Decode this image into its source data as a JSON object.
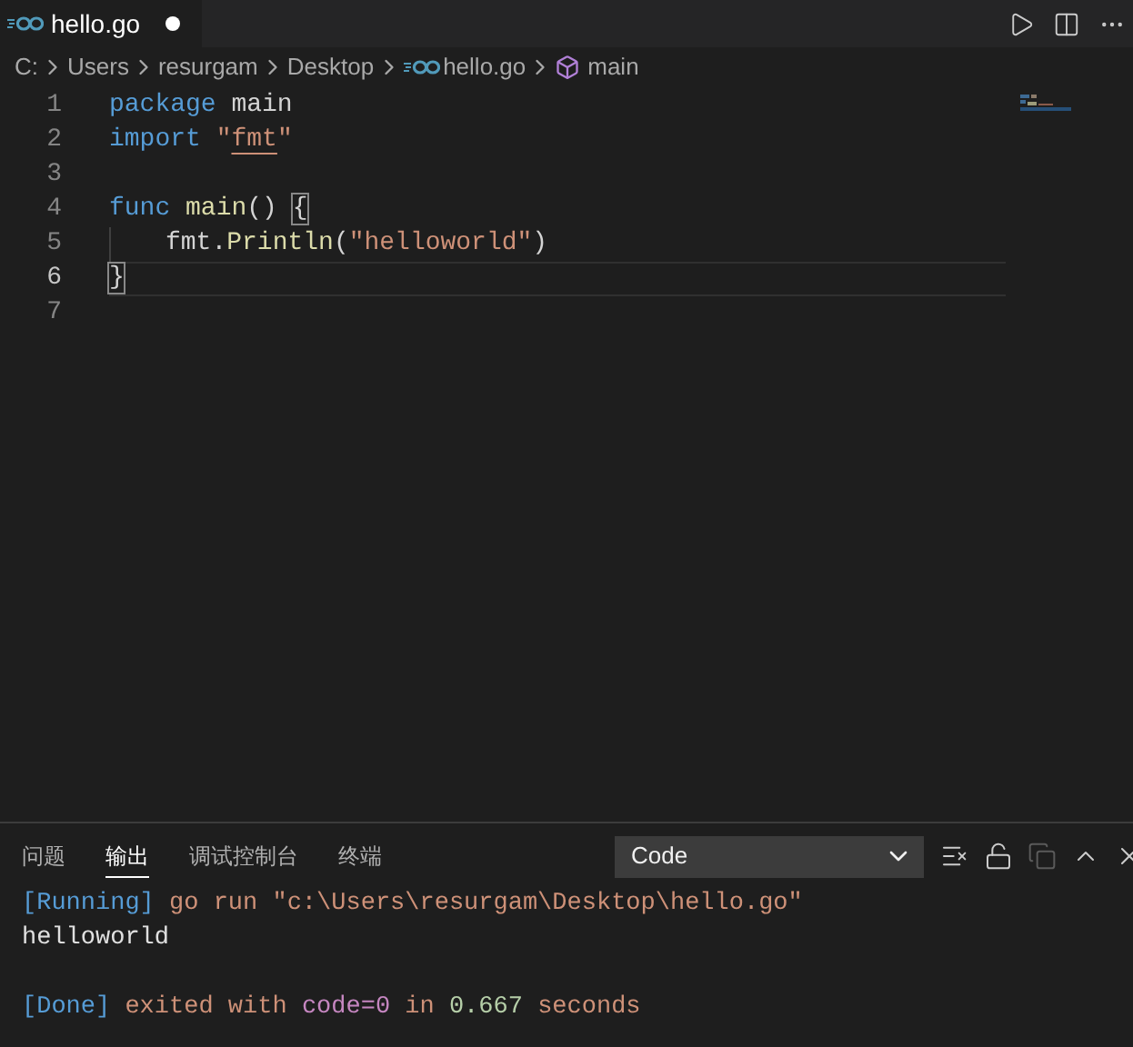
{
  "tab": {
    "label": "hello.go",
    "modified": true,
    "selected": true
  },
  "breadcrumbs": [
    {
      "label": "C:",
      "kind": "folder"
    },
    {
      "label": "Users",
      "kind": "folder"
    },
    {
      "label": "resurgam",
      "kind": "folder"
    },
    {
      "label": "Desktop",
      "kind": "folder"
    },
    {
      "label": "hello.go",
      "kind": "file"
    },
    {
      "label": "main",
      "kind": "symbol"
    }
  ],
  "code_lines": [
    {
      "number": "1",
      "current": false,
      "indent": false,
      "tokens": [
        {
          "text": "package",
          "kind": "keyword"
        },
        {
          "text": " main",
          "kind": "plain"
        }
      ]
    },
    {
      "number": "2",
      "current": false,
      "indent": false,
      "tokens": [
        {
          "text": "import",
          "kind": "keyword"
        },
        {
          "text": " \"",
          "kind": "string"
        },
        {
          "text": "fmt",
          "kind": "string",
          "underline": true
        },
        {
          "text": "\"",
          "kind": "string"
        }
      ]
    },
    {
      "number": "3",
      "current": false,
      "indent": false
    },
    {
      "number": "4",
      "current": false,
      "indent": false,
      "tokens": [
        {
          "text": "func",
          "kind": "keyword"
        },
        {
          "text": " main",
          "kind": "function"
        },
        {
          "text": "() ",
          "kind": "plain"
        },
        {
          "text": "{",
          "kind": "plain",
          "bracket_match": true
        }
      ]
    },
    {
      "number": "5",
      "current": false,
      "indent": true,
      "tokens": [
        {
          "text": "fmt",
          "kind": "plain"
        },
        {
          "text": ".",
          "kind": "plain"
        },
        {
          "text": "Println",
          "kind": "function"
        },
        {
          "text": "(",
          "kind": "plain"
        },
        {
          "text": "\"helloworld\"",
          "kind": "string"
        },
        {
          "text": ")",
          "kind": "plain"
        }
      ]
    },
    {
      "number": "6",
      "current": true,
      "indent": false,
      "tokens": [
        {
          "text": "}",
          "kind": "plain",
          "bracket_match": true
        }
      ]
    },
    {
      "number": "7",
      "current": false,
      "indent": false
    }
  ],
  "panel": {
    "tabs": [
      {
        "label": "问题",
        "selected": false
      },
      {
        "label": "输出",
        "selected": true
      },
      {
        "label": "调试控制台",
        "selected": false
      },
      {
        "label": "终端",
        "selected": false
      }
    ],
    "channel_select": {
      "value": "Code"
    },
    "output_lines": [
      {
        "kind": "text",
        "tokens": [
          {
            "text": "[Running]",
            "kind": "bracket"
          },
          {
            "text": " go run \"c:\\Users\\resurgam\\Desktop\\hello.go\"",
            "kind": "text"
          }
        ]
      },
      {
        "kind": "text",
        "tokens": [
          {
            "text": "helloworld",
            "kind": "plain"
          }
        ]
      },
      {
        "kind": "blank"
      },
      {
        "kind": "text",
        "tokens": [
          {
            "text": "[Done]",
            "kind": "bracket"
          },
          {
            "text": " exited with ",
            "kind": "text"
          },
          {
            "text": "code=0",
            "kind": "keyword"
          },
          {
            "text": " in ",
            "kind": "text"
          },
          {
            "text": "0.667",
            "kind": "number"
          },
          {
            "text": " seconds",
            "kind": "text"
          }
        ]
      }
    ]
  }
}
